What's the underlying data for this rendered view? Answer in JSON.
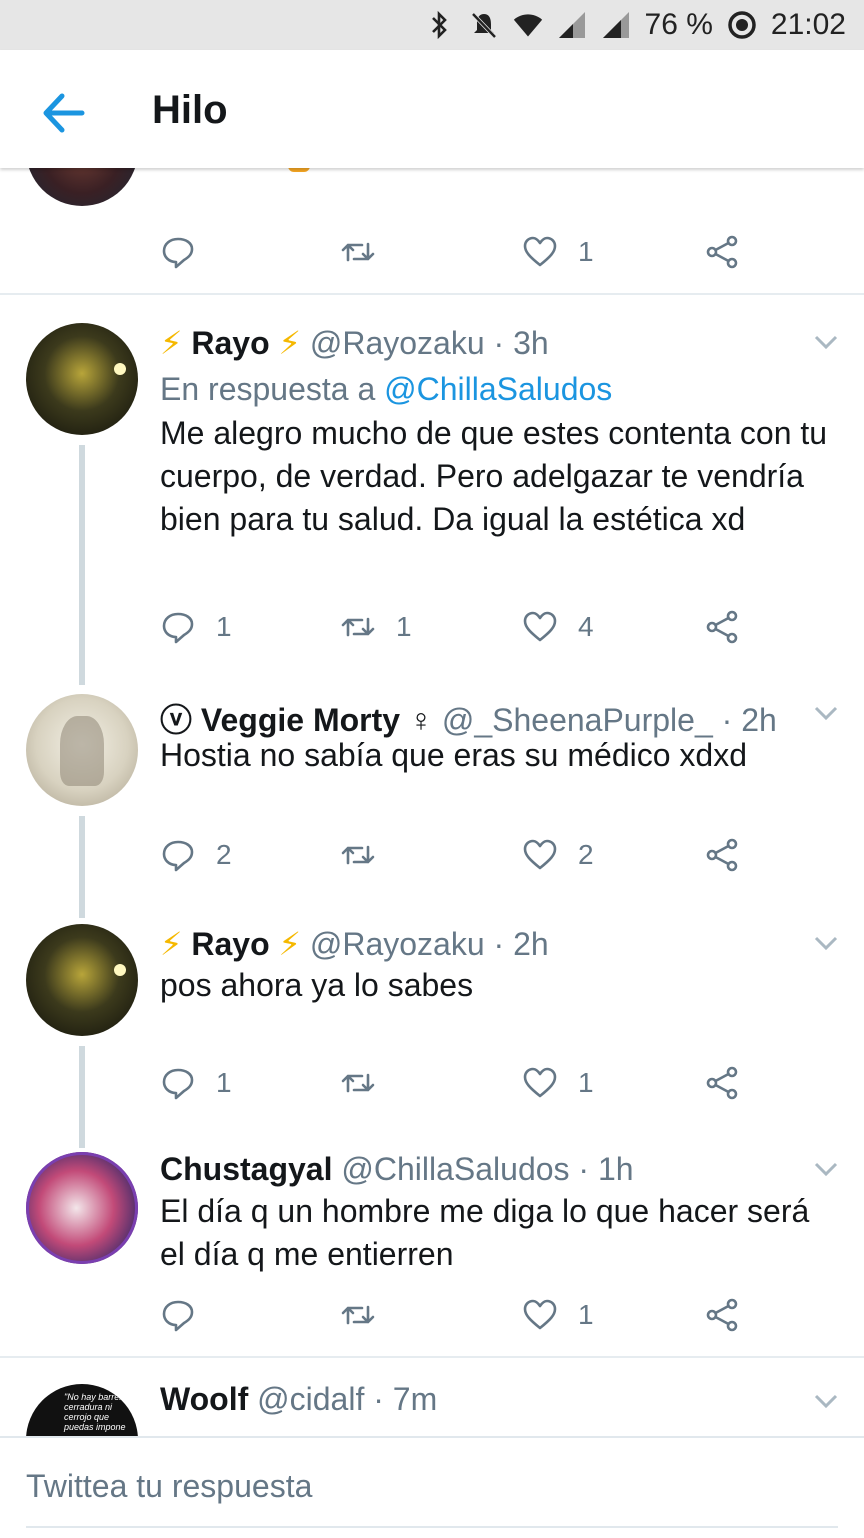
{
  "status_bar": {
    "battery": "76 %",
    "time": "21:02"
  },
  "header": {
    "title": "Hilo"
  },
  "top_tweet": {
    "likes": "1"
  },
  "tweets": [
    {
      "name_prefix": "⚡",
      "name": "Rayo",
      "name_suffix": "⚡",
      "handle": "@Rayozaku",
      "time": "· 3h",
      "reply_prefix": "En respuesta a",
      "reply_mention": "@ChillaSaludos",
      "text": "Me alegro mucho de que estes contenta con tu cuerpo, de verdad. Pero adelgazar te vendría bien para tu salud. Da igual la estética xd",
      "replies": "1",
      "retweets": "1",
      "likes": "4"
    },
    {
      "name_prefix": "ⓥ",
      "name": "Veggie Morty",
      "name_suffix": "♀",
      "handle": "@_SheenaPurple_",
      "time": "· 2h",
      "text": "Hostia no sabía que eras su médico xdxd",
      "replies": "2",
      "retweets": "",
      "likes": "2"
    },
    {
      "name_prefix": "⚡",
      "name": "Rayo",
      "name_suffix": "⚡",
      "handle": "@Rayozaku",
      "time": "· 2h",
      "text": "pos ahora ya lo sabes",
      "replies": "1",
      "retweets": "",
      "likes": "1"
    },
    {
      "name": "Chustagyal",
      "handle": "@ChillaSaludos",
      "time": "· 1h",
      "text": "El día q un hombre me diga lo que hacer será el día q me entierren",
      "replies": "",
      "retweets": "",
      "likes": "1"
    },
    {
      "name": "Woolf",
      "handle": "@cidalf",
      "time": "· 7m",
      "avatar_text": "\"No hay barrera, cerradura ni cerrojo que puedas impone"
    }
  ],
  "composer": {
    "placeholder": "Twittea tu respuesta"
  },
  "colors": {
    "accent": "#1b95e0",
    "secondary_text": "#657786",
    "lightning": "#f5b800"
  }
}
